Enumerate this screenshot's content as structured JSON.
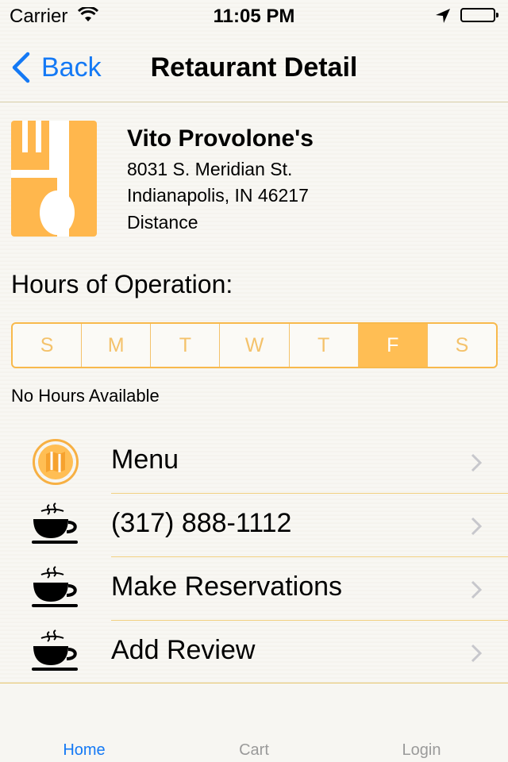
{
  "status_bar": {
    "carrier": "Carrier",
    "time": "11:05 PM"
  },
  "nav": {
    "back_label": "Back",
    "title": "Retaurant Detail"
  },
  "restaurant": {
    "name": "Vito Provolone's",
    "address_line1": "8031 S. Meridian St.",
    "address_line2": "Indianapolis, IN 46217",
    "distance_label": "Distance"
  },
  "hours": {
    "title": "Hours of Operation:",
    "days": [
      "S",
      "M",
      "T",
      "W",
      "T",
      "F",
      "S"
    ],
    "selected_day": "F",
    "message": "No Hours Available"
  },
  "actions": [
    {
      "label": "Menu",
      "icon": "map-icon"
    },
    {
      "label": "(317) 888-1112",
      "icon": "coffee-cup-icon"
    },
    {
      "label": "Make Reservations",
      "icon": "coffee-cup-icon"
    },
    {
      "label": "Add Review",
      "icon": "coffee-cup-icon"
    }
  ],
  "tabs": [
    {
      "label": "Home",
      "active": true
    },
    {
      "label": "Cart",
      "active": false
    },
    {
      "label": "Login",
      "active": false
    }
  ],
  "colors": {
    "accent": "#1479f5",
    "brand_orange": "#ffb74d"
  }
}
